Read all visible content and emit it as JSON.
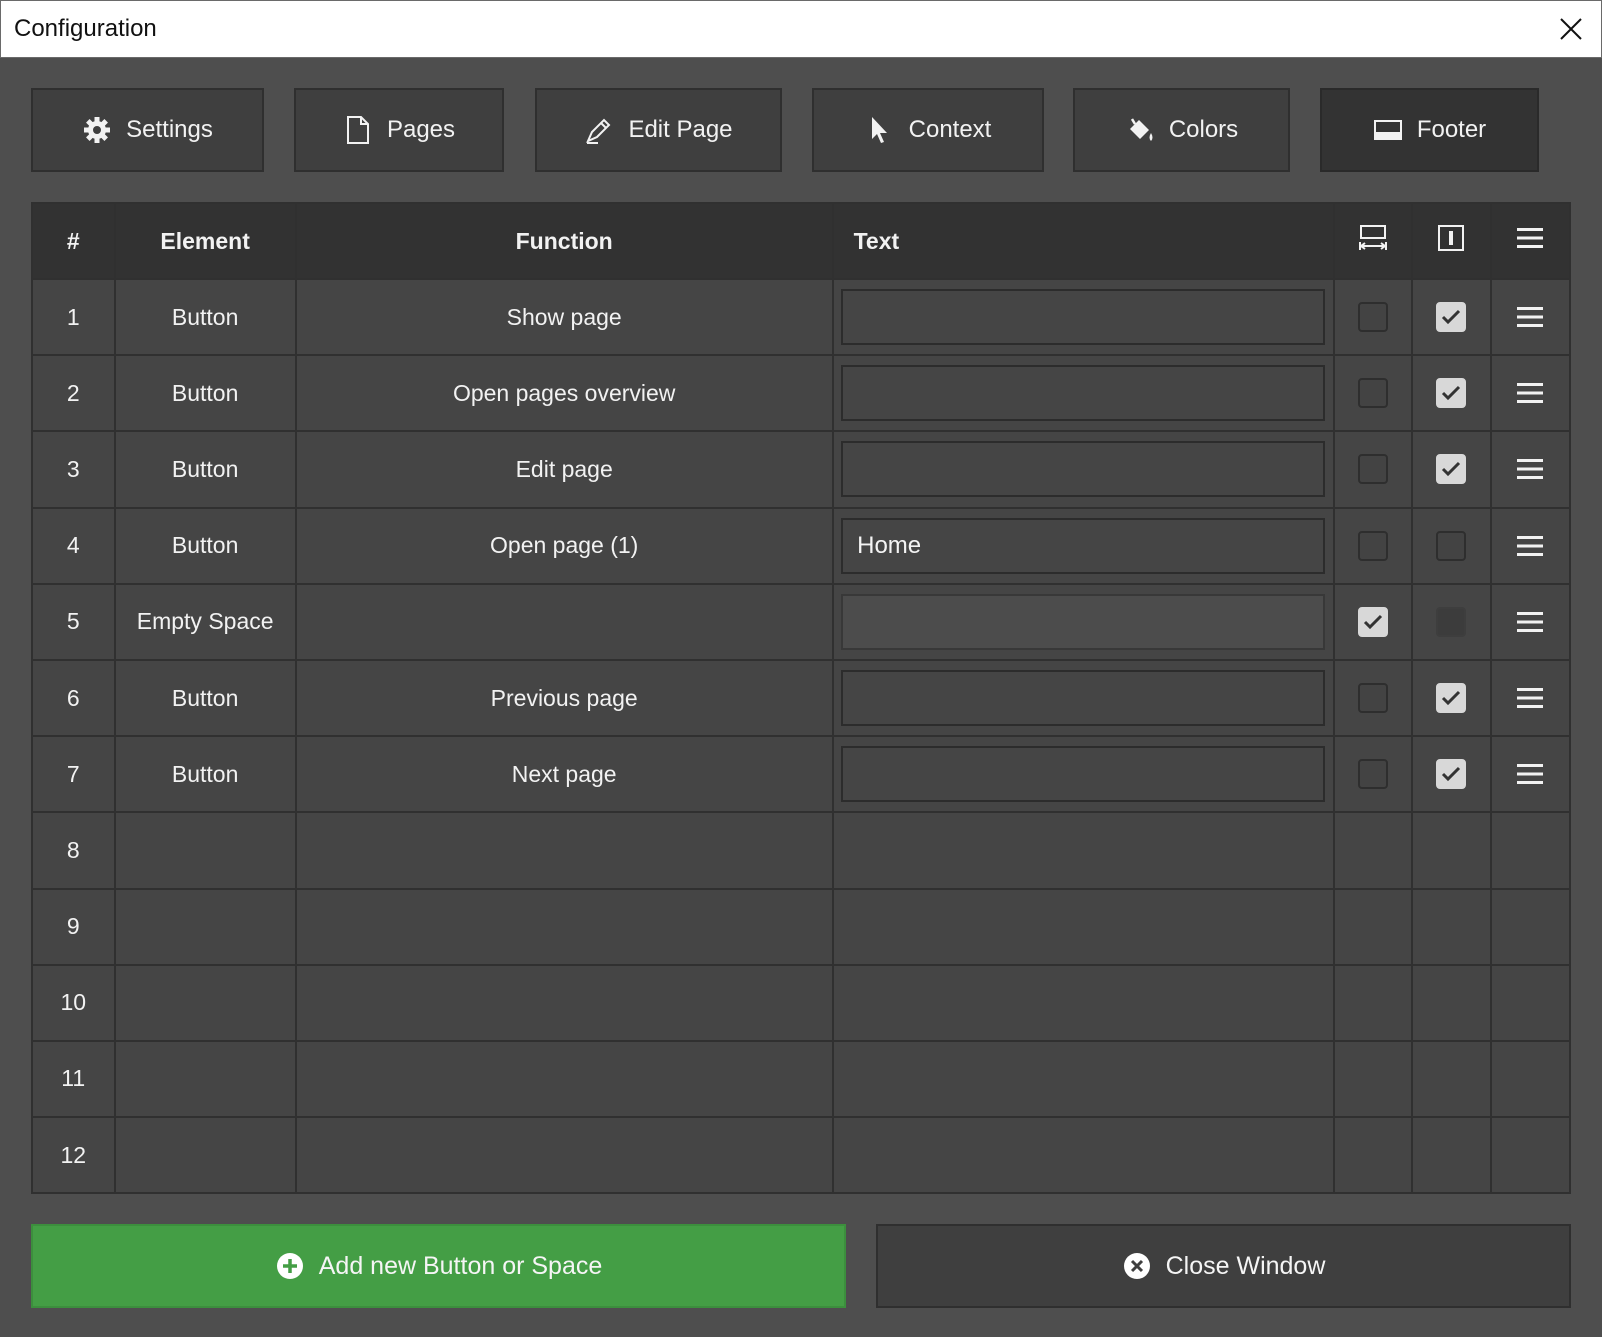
{
  "window": {
    "title": "Configuration"
  },
  "tabs": [
    {
      "label": "Settings",
      "icon": "gear-icon",
      "active": false
    },
    {
      "label": "Pages",
      "icon": "page-icon",
      "active": false
    },
    {
      "label": "Edit Page",
      "icon": "pen-icon",
      "active": false
    },
    {
      "label": "Context",
      "icon": "cursor-icon",
      "active": false
    },
    {
      "label": "Colors",
      "icon": "paint-bucket-icon",
      "active": false
    },
    {
      "label": "Footer",
      "icon": "footer-icon",
      "active": true
    }
  ],
  "table": {
    "headers": {
      "number": "#",
      "element": "Element",
      "function": "Function",
      "text": "Text",
      "col5_icon": "stretch-width-icon",
      "col6_icon": "text-cursor-icon",
      "col7_icon": "menu-icon"
    },
    "rows": [
      {
        "num": "1",
        "element": "Button",
        "function": "Show page",
        "text": "",
        "stretch": false,
        "show_text": true,
        "show_text_enabled": true
      },
      {
        "num": "2",
        "element": "Button",
        "function": "Open pages overview",
        "text": "",
        "stretch": false,
        "show_text": true,
        "show_text_enabled": true
      },
      {
        "num": "3",
        "element": "Button",
        "function": "Edit page",
        "text": "",
        "stretch": false,
        "show_text": true,
        "show_text_enabled": true
      },
      {
        "num": "4",
        "element": "Button",
        "function": "Open page (1)",
        "text": "Home",
        "stretch": false,
        "show_text": false,
        "show_text_enabled": true
      },
      {
        "num": "5",
        "element": "Empty Space",
        "function": "",
        "text": "",
        "stretch": true,
        "show_text": false,
        "show_text_enabled": false
      },
      {
        "num": "6",
        "element": "Button",
        "function": "Previous page",
        "text": "",
        "stretch": false,
        "show_text": true,
        "show_text_enabled": true
      },
      {
        "num": "7",
        "element": "Button",
        "function": "Next page",
        "text": "",
        "stretch": false,
        "show_text": true,
        "show_text_enabled": true
      }
    ],
    "empty_rows": [
      "8",
      "9",
      "10",
      "11",
      "12"
    ]
  },
  "actions": {
    "add_label": "Add new Button or Space",
    "close_label": "Close Window"
  },
  "colors": {
    "background": "#4e4e4e",
    "add_button": "#449e45",
    "tab_active": "#333333"
  }
}
